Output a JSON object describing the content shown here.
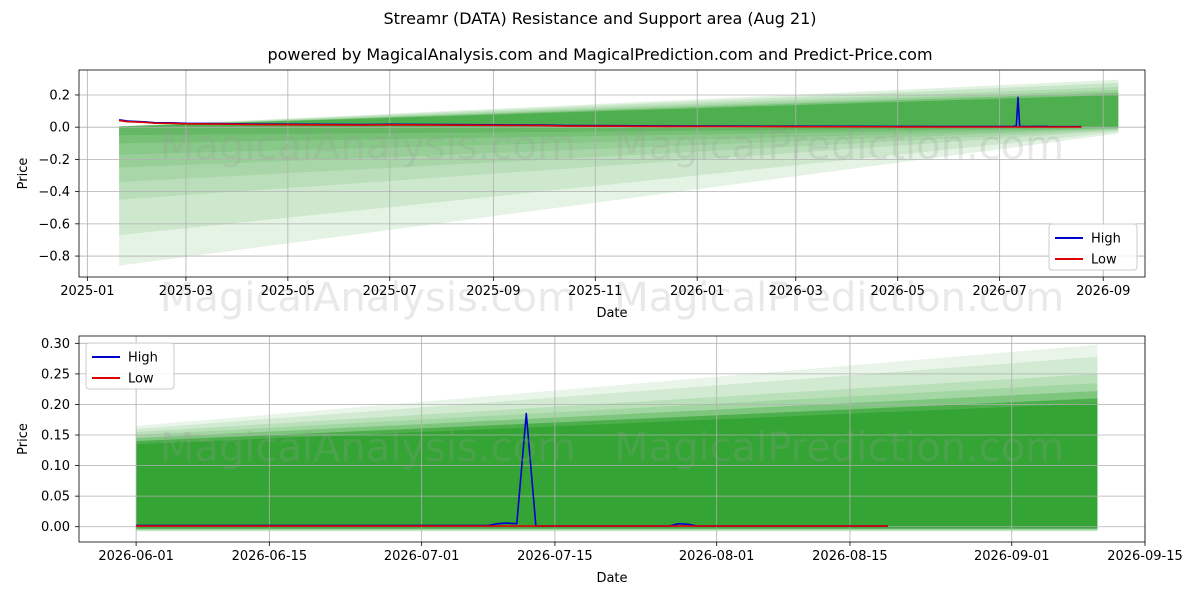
{
  "figure": {
    "title": "Streamr (DATA) Resistance and Support area (Aug 21)",
    "subtitle": "powered by MagicalAnalysis.com and MagicalPrediction.com and Predict-Price.com",
    "watermark": "MagicalAnalysis.com   MagicalPrediction.com",
    "colors": {
      "high": "#0000cc",
      "low": "#dd0000",
      "band": "#2ca02c",
      "grid": "#b0b0b0"
    }
  },
  "chart_data": [
    {
      "type": "line",
      "xlabel": "Date",
      "ylabel": "Price",
      "x_type": "date",
      "xlim": [
        "2024-12-27",
        "2026-09-26"
      ],
      "ylim": [
        -0.93,
        0.355
      ],
      "x_ticks": [
        "2025-01-01",
        "2025-03-01",
        "2025-05-01",
        "2025-07-01",
        "2025-09-01",
        "2025-11-01",
        "2026-01-01",
        "2026-03-01",
        "2026-05-01",
        "2026-07-01",
        "2026-09-01"
      ],
      "x_tick_labels": [
        "2025-01",
        "2025-03",
        "2025-05",
        "2025-07",
        "2025-09",
        "2025-11",
        "2026-01",
        "2026-03",
        "2026-05",
        "2026-07",
        "2026-09"
      ],
      "y_ticks": [
        0.2,
        0.0,
        -0.2,
        -0.4,
        -0.6,
        -0.8
      ],
      "y_tick_labels": [
        "0.2",
        "0.0",
        "−0.2",
        "−0.4",
        "−0.6",
        "−0.8"
      ],
      "grid": true,
      "legend": {
        "position": "lower-right",
        "entries": [
          "High",
          "Low"
        ]
      },
      "series": [
        {
          "name": "High",
          "color": "#0000cc",
          "points": [
            [
              "2025-01-20",
              0.046
            ],
            [
              "2025-01-25",
              0.038
            ],
            [
              "2025-02-05",
              0.033
            ],
            [
              "2025-02-10",
              0.028
            ],
            [
              "2025-02-20",
              0.027
            ],
            [
              "2025-03-01",
              0.024
            ],
            [
              "2025-03-20",
              0.022
            ],
            [
              "2025-04-15",
              0.019
            ],
            [
              "2025-05-15",
              0.018
            ],
            [
              "2025-06-15",
              0.016
            ],
            [
              "2025-07-01",
              0.018
            ],
            [
              "2025-08-01",
              0.016
            ],
            [
              "2025-09-01",
              0.015
            ],
            [
              "2025-10-01",
              0.013
            ],
            [
              "2025-10-15",
              0.01
            ],
            [
              "2025-11-15",
              0.009
            ],
            [
              "2025-12-15",
              0.008
            ],
            [
              "2026-01-15",
              0.007
            ],
            [
              "2026-03-01",
              0.006
            ],
            [
              "2026-05-01",
              0.005
            ],
            [
              "2026-06-01",
              0.004
            ],
            [
              "2026-07-09",
              0.005
            ],
            [
              "2026-07-10",
              0.006
            ],
            [
              "2026-07-11",
              0.006
            ],
            [
              "2026-07-12",
              0.185
            ],
            [
              "2026-07-13",
              0.004
            ],
            [
              "2026-07-28",
              0.005
            ],
            [
              "2026-07-31",
              0.003
            ],
            [
              "2026-08-19",
              0.003
            ]
          ]
        },
        {
          "name": "Low",
          "color": "#dd0000",
          "points": [
            [
              "2025-01-20",
              0.041
            ],
            [
              "2025-01-25",
              0.034
            ],
            [
              "2025-02-05",
              0.03
            ],
            [
              "2025-02-10",
              0.025
            ],
            [
              "2025-02-20",
              0.024
            ],
            [
              "2025-03-01",
              0.021
            ],
            [
              "2025-03-20",
              0.019
            ],
            [
              "2025-04-15",
              0.016
            ],
            [
              "2025-05-15",
              0.015
            ],
            [
              "2025-06-15",
              0.013
            ],
            [
              "2025-07-01",
              0.015
            ],
            [
              "2025-08-01",
              0.013
            ],
            [
              "2025-09-01",
              0.012
            ],
            [
              "2025-10-01",
              0.01
            ],
            [
              "2025-10-15",
              0.007
            ],
            [
              "2025-11-15",
              0.006
            ],
            [
              "2025-12-15",
              0.005
            ],
            [
              "2026-01-15",
              0.004
            ],
            [
              "2026-03-01",
              0.003
            ],
            [
              "2026-05-01",
              0.002
            ],
            [
              "2026-06-01",
              0.001
            ],
            [
              "2026-07-12",
              0.001
            ],
            [
              "2026-08-19",
              0.001
            ]
          ]
        }
      ],
      "bands": [
        {
          "x": [
            "2025-01-20",
            "2026-09-10"
          ],
          "upper": [
            0.0,
            0.0
          ],
          "lower": [
            -0.86,
            -0.04
          ],
          "alpha": 0.12
        },
        {
          "x": [
            "2025-01-20",
            "2026-09-10"
          ],
          "upper": [
            0.0,
            0.0
          ],
          "lower": [
            -0.67,
            -0.03
          ],
          "alpha": 0.12
        },
        {
          "x": [
            "2025-01-20",
            "2026-09-10"
          ],
          "upper": [
            0.0,
            0.0
          ],
          "lower": [
            -0.45,
            -0.02
          ],
          "alpha": 0.12
        },
        {
          "x": [
            "2025-01-20",
            "2026-09-10"
          ],
          "upper": [
            0.0,
            0.0
          ],
          "lower": [
            -0.34,
            -0.015
          ],
          "alpha": 0.12
        },
        {
          "x": [
            "2025-01-20",
            "2026-09-10"
          ],
          "upper": [
            0.0,
            0.0
          ],
          "lower": [
            -0.25,
            -0.01
          ],
          "alpha": 0.12
        },
        {
          "x": [
            "2025-01-20",
            "2026-09-10"
          ],
          "upper": [
            0.0,
            0.0
          ],
          "lower": [
            -0.17,
            -0.008
          ],
          "alpha": 0.15
        },
        {
          "x": [
            "2025-01-20",
            "2026-09-10"
          ],
          "upper": [
            0.0,
            0.0
          ],
          "lower": [
            -0.1,
            -0.005
          ],
          "alpha": 0.18
        },
        {
          "x": [
            "2025-01-20",
            "2026-09-10"
          ],
          "upper": [
            0.0,
            0.0
          ],
          "lower": [
            -0.05,
            -0.003
          ],
          "alpha": 0.25
        },
        {
          "x": [
            "2025-01-20",
            "2026-09-10"
          ],
          "upper": [
            0.005,
            0.295
          ],
          "lower": [
            0.0,
            0.0
          ],
          "alpha": 0.14
        },
        {
          "x": [
            "2025-01-20",
            "2026-09-10"
          ],
          "upper": [
            0.005,
            0.275
          ],
          "lower": [
            0.0,
            0.0
          ],
          "alpha": 0.14
        },
        {
          "x": [
            "2025-01-20",
            "2026-09-10"
          ],
          "upper": [
            0.005,
            0.25
          ],
          "lower": [
            0.0,
            0.0
          ],
          "alpha": 0.14
        },
        {
          "x": [
            "2025-01-20",
            "2026-09-10"
          ],
          "upper": [
            0.005,
            0.23
          ],
          "lower": [
            0.0,
            0.0
          ],
          "alpha": 0.16
        },
        {
          "x": [
            "2025-01-20",
            "2026-09-10"
          ],
          "upper": [
            0.005,
            0.215
          ],
          "lower": [
            0.0,
            0.0
          ],
          "alpha": 0.3
        },
        {
          "x": [
            "2025-01-20",
            "2026-09-10"
          ],
          "upper": [
            0.005,
            0.2
          ],
          "lower": [
            0.0,
            0.0
          ],
          "alpha": 0.55
        }
      ]
    },
    {
      "type": "line",
      "xlabel": "Date",
      "ylabel": "Price",
      "x_type": "date",
      "xlim": [
        "2026-05-26",
        "2026-09-15"
      ],
      "ylim": [
        -0.025,
        0.312
      ],
      "x_ticks": [
        "2026-06-01",
        "2026-06-15",
        "2026-07-01",
        "2026-07-15",
        "2026-08-01",
        "2026-08-15",
        "2026-09-01",
        "2026-09-15"
      ],
      "x_tick_labels": [
        "2026-06-01",
        "2026-06-15",
        "2026-07-01",
        "2026-07-15",
        "2026-08-01",
        "2026-08-15",
        "2026-09-01",
        "2026-09-15"
      ],
      "y_ticks": [
        0.3,
        0.25,
        0.2,
        0.15,
        0.1,
        0.05,
        0.0
      ],
      "y_tick_labels": [
        "0.30",
        "0.25",
        "0.20",
        "0.15",
        "0.10",
        "0.05",
        "0.00"
      ],
      "grid": true,
      "legend": {
        "position": "upper-left",
        "entries": [
          "High",
          "Low"
        ]
      },
      "series": [
        {
          "name": "High",
          "color": "#0000cc",
          "points": [
            [
              "2026-06-01",
              0.002
            ],
            [
              "2026-06-15",
              0.002
            ],
            [
              "2026-07-01",
              0.002
            ],
            [
              "2026-07-08",
              0.002
            ],
            [
              "2026-07-09",
              0.005
            ],
            [
              "2026-07-10",
              0.006
            ],
            [
              "2026-07-11",
              0.005
            ],
            [
              "2026-07-12",
              0.185
            ],
            [
              "2026-07-13",
              0.001
            ],
            [
              "2026-07-27",
              0.001
            ],
            [
              "2026-07-28",
              0.005
            ],
            [
              "2026-07-29",
              0.004
            ],
            [
              "2026-07-30",
              0.001
            ],
            [
              "2026-08-19",
              0.001
            ]
          ]
        },
        {
          "name": "Low",
          "color": "#dd0000",
          "points": [
            [
              "2026-06-01",
              0.001
            ],
            [
              "2026-07-01",
              0.001
            ],
            [
              "2026-08-01",
              0.001
            ],
            [
              "2026-08-19",
              0.001
            ]
          ]
        }
      ],
      "bands": [
        {
          "x": [
            "2026-06-01",
            "2026-09-10"
          ],
          "upper": [
            0.165,
            0.298
          ],
          "lower": [
            -0.008,
            -0.008
          ],
          "alpha": 0.1
        },
        {
          "x": [
            "2026-06-01",
            "2026-09-10"
          ],
          "upper": [
            0.16,
            0.278
          ],
          "lower": [
            -0.007,
            -0.007
          ],
          "alpha": 0.12
        },
        {
          "x": [
            "2026-06-01",
            "2026-09-10"
          ],
          "upper": [
            0.155,
            0.25
          ],
          "lower": [
            -0.006,
            -0.006
          ],
          "alpha": 0.14
        },
        {
          "x": [
            "2026-06-01",
            "2026-09-10"
          ],
          "upper": [
            0.15,
            0.235
          ],
          "lower": [
            -0.005,
            -0.005
          ],
          "alpha": 0.16
        },
        {
          "x": [
            "2026-06-01",
            "2026-09-10"
          ],
          "upper": [
            0.145,
            0.222
          ],
          "lower": [
            -0.004,
            -0.004
          ],
          "alpha": 0.3
        },
        {
          "x": [
            "2026-06-01",
            "2026-09-10"
          ],
          "upper": [
            0.14,
            0.21
          ],
          "lower": [
            -0.003,
            -0.003
          ],
          "alpha": 0.6
        },
        {
          "x": [
            "2026-06-01",
            "2026-09-10"
          ],
          "upper": [
            0.135,
            0.202
          ],
          "lower": [
            -0.002,
            -0.002
          ],
          "alpha": 0.75
        }
      ]
    }
  ]
}
